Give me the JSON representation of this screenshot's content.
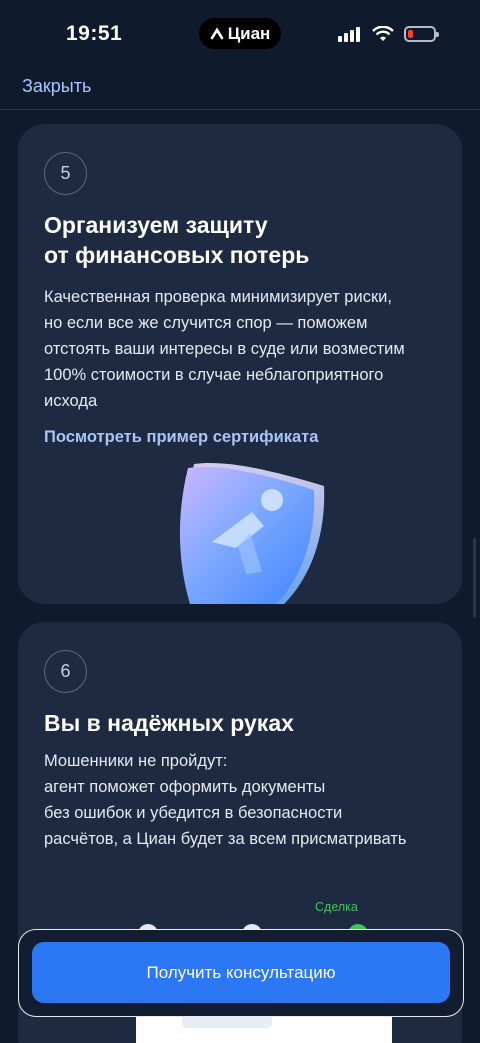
{
  "status_bar": {
    "time": "19:51",
    "app_pill": "Циан",
    "icons": [
      "signal-icon",
      "wifi-icon",
      "battery-low-icon"
    ]
  },
  "nav": {
    "close_label": "Закрыть"
  },
  "cards": [
    {
      "step": "5",
      "title_line1": "Организуем защиту",
      "title_line2": "от финансовых потерь",
      "text_lines": [
        "Качественная проверка минимизирует риски,",
        "но если все же случится спор — поможем",
        "отстоять ваши интересы в суде или возместим",
        "100% стоимости в случае неблагоприятного",
        "исхода"
      ],
      "link": "Посмотреть пример сертификата",
      "illustration": "shield-icon"
    },
    {
      "step": "6",
      "title": "Вы в надёжных руках",
      "text_lines": [
        "Мошенники не пройдут:",
        "агент поможет оформить документы",
        "без ошибок и убедится в безопасности",
        "расчётов, а Циан будет за всем присматривать"
      ],
      "deal_label": "Сделка"
    }
  ],
  "cta": {
    "label": "Получить консультацию"
  },
  "colors": {
    "background": "#101a2d",
    "card": "#1e2a42",
    "accent_blue": "#2c77f4",
    "link": "#aac6ff",
    "deal_green": "#3ec25e"
  }
}
